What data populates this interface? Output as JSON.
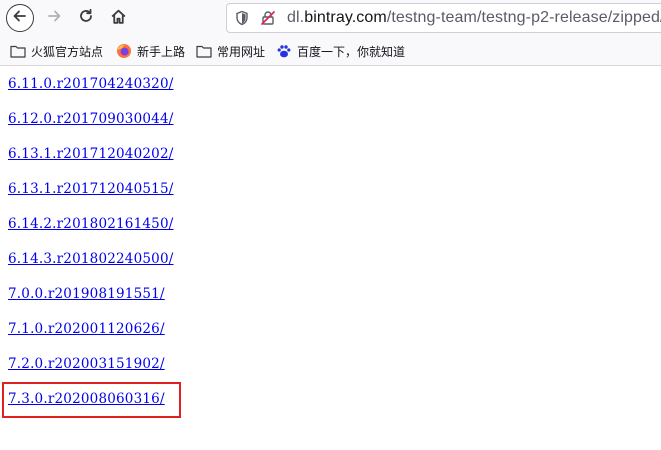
{
  "toolbar": {
    "url_host_prefix": "dl.",
    "url_host": "bintray.com",
    "url_path": "/testng-team/testng-p2-release/zipped/",
    "icons": [
      "back-icon",
      "forward-icon",
      "reload-icon",
      "home-icon",
      "shield-icon",
      "insecure-lock-icon"
    ]
  },
  "bookmarks": [
    {
      "label": "火狐官方站点",
      "icon": "folder-icon"
    },
    {
      "label": "新手上路",
      "icon": "firefox-icon"
    },
    {
      "label": "常用网址",
      "icon": "folder-icon"
    },
    {
      "label": "百度一下，你就知道",
      "icon": "baidu-paw-icon"
    }
  ],
  "links": [
    "6.11.0.r201704240320/",
    "6.12.0.r201709030044/",
    "6.13.1.r201712040202/",
    "6.13.1.r201712040515/",
    "6.14.2.r201802161450/",
    "6.14.3.r201802240500/",
    "7.0.0.r201908191551/",
    "7.1.0.r202001120626/",
    "7.2.0.r202003151902/",
    "7.3.0.r202008060316/"
  ],
  "colors": {
    "link": "#0000ee",
    "highlight": "#e02020"
  }
}
